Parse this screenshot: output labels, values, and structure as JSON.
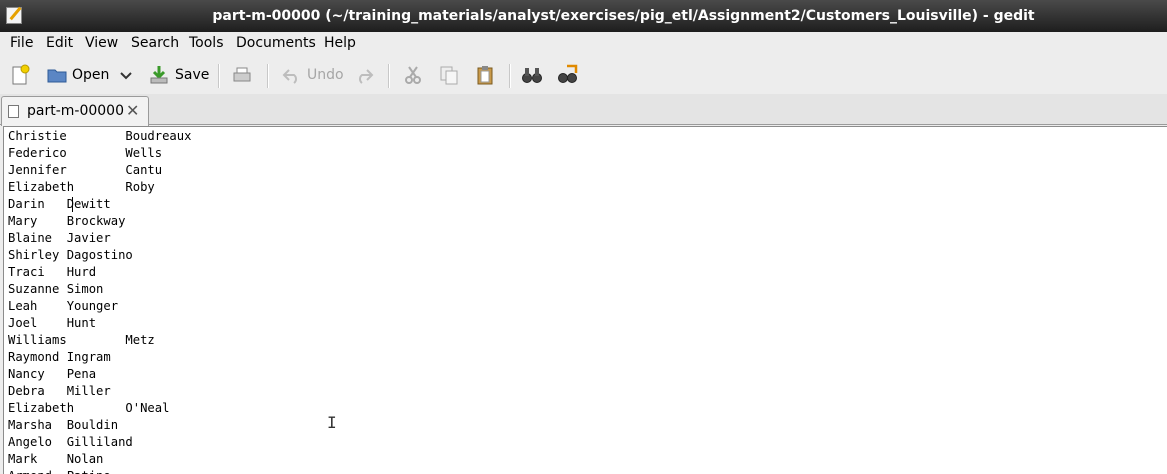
{
  "window": {
    "title": "part-m-00000 (~/training_materials/analyst/exercises/pig_etl/Assignment2/Customers_Louisville) - gedit"
  },
  "menu": [
    "File",
    "Edit",
    "View",
    "Search",
    "Tools",
    "Documents",
    "Help"
  ],
  "toolbar": {
    "open_label": "Open",
    "save_label": "Save",
    "undo_label": "Undo"
  },
  "tab": {
    "label": "part-m-00000"
  },
  "document": {
    "lines": [
      [
        "Christie",
        "Boudreaux"
      ],
      [
        "Federico",
        "Wells"
      ],
      [
        "Jennifer",
        "Cantu"
      ],
      [
        "Elizabeth",
        "Roby"
      ],
      [
        "Darin",
        "Dewitt"
      ],
      [
        "Mary",
        "Brockway"
      ],
      [
        "Blaine",
        "Javier"
      ],
      [
        "Shirley",
        "Dagostino"
      ],
      [
        "Traci",
        "Hurd"
      ],
      [
        "Suzanne",
        "Simon"
      ],
      [
        "Leah",
        "Younger"
      ],
      [
        "Joel",
        "Hunt"
      ],
      [
        "Williams",
        "Metz"
      ],
      [
        "Raymond",
        "Ingram"
      ],
      [
        "Nancy",
        "Pena"
      ],
      [
        "Debra",
        "Miller"
      ],
      [
        "Elizabeth",
        "O'Neal"
      ],
      [
        "Marsha",
        "Bouldin"
      ],
      [
        "Angelo",
        "Gilliland"
      ],
      [
        "Mark",
        "Nolan"
      ],
      [
        "Armond",
        "Patino"
      ]
    ]
  },
  "colors": {
    "titlebar": "#2a2a2a",
    "chrome": "#ededed",
    "editor_bg": "#ffffff"
  }
}
